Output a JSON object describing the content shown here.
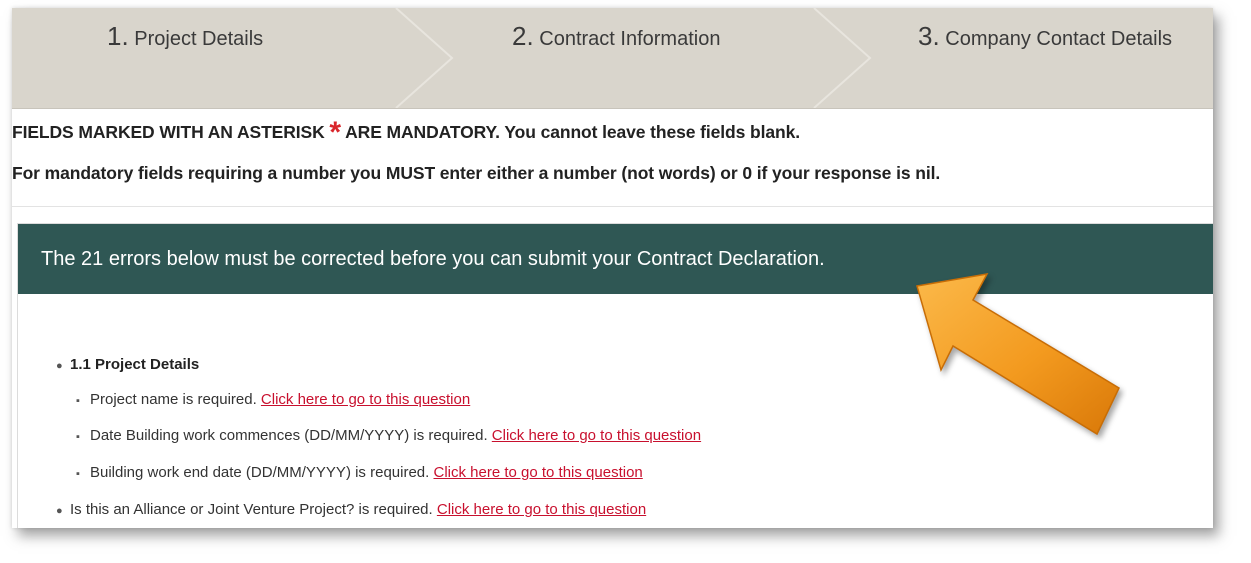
{
  "steps": [
    {
      "number": "1.",
      "label": "Project Details"
    },
    {
      "number": "2.",
      "label": "Contract Information"
    },
    {
      "number": "3.",
      "label": "Company Contact Details"
    }
  ],
  "notice": {
    "line1_prefix": "FIELDS MARKED WITH AN ASTERISK",
    "asterisk": "*",
    "line1_suffix": "ARE MANDATORY. You cannot leave these fields blank.",
    "line2": "For mandatory fields requiring a number you MUST enter either a number (not words) or 0 if your response is nil."
  },
  "error_panel": {
    "header": "The 21 errors below must be corrected before you can submit your Contract Declaration.",
    "section_title": "1.1 Project Details",
    "link_text": "Click here to go to this question",
    "items": [
      {
        "text": "Project name is required."
      },
      {
        "text": "Date Building work commences (DD/MM/YYYY) is required."
      },
      {
        "text": "Building work end date (DD/MM/YYYY) is required."
      }
    ],
    "extra_item": {
      "text": "Is this an Alliance or Joint Venture Project? is required."
    }
  },
  "colors": {
    "steps_bg": "#d9d5cc",
    "panel_header_bg": "#2f5754",
    "link": "#c8102e",
    "asterisk": "#d9262b",
    "arrow": "#f39a1f"
  },
  "icons": {
    "arrow": "orange-arrow-pointer"
  }
}
